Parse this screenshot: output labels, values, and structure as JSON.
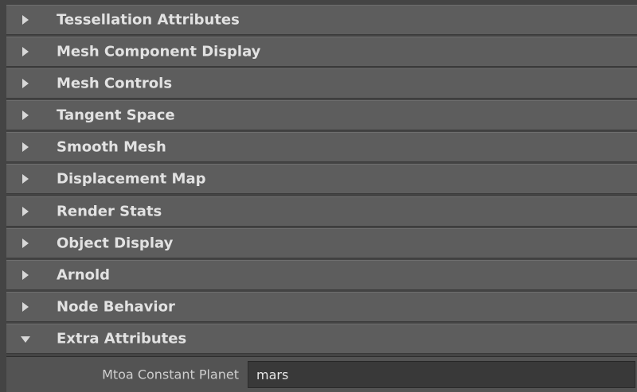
{
  "sections": [
    {
      "label": "Tessellation Attributes",
      "state": "collapsed"
    },
    {
      "label": "Mesh Component Display",
      "state": "collapsed"
    },
    {
      "label": "Mesh Controls",
      "state": "collapsed"
    },
    {
      "label": "Tangent Space",
      "state": "collapsed"
    },
    {
      "label": "Smooth Mesh",
      "state": "collapsed"
    },
    {
      "label": "Displacement Map",
      "state": "collapsed"
    },
    {
      "label": "Render Stats",
      "state": "collapsed"
    },
    {
      "label": "Object Display",
      "state": "collapsed"
    },
    {
      "label": "Arnold",
      "state": "collapsed"
    },
    {
      "label": "Node Behavior",
      "state": "collapsed"
    },
    {
      "label": "Extra Attributes",
      "state": "expanded"
    }
  ],
  "extra_attributes": {
    "fields": [
      {
        "label": "Mtoa Constant Planet",
        "value": "mars"
      }
    ]
  },
  "icons": {
    "collapsed": "triangle-right-icon",
    "expanded": "triangle-down-icon"
  },
  "colors": {
    "header_bg": "#5d5d5d",
    "panel_bg": "#444444",
    "text": "#e2e2e2",
    "field_bg": "#393939"
  }
}
